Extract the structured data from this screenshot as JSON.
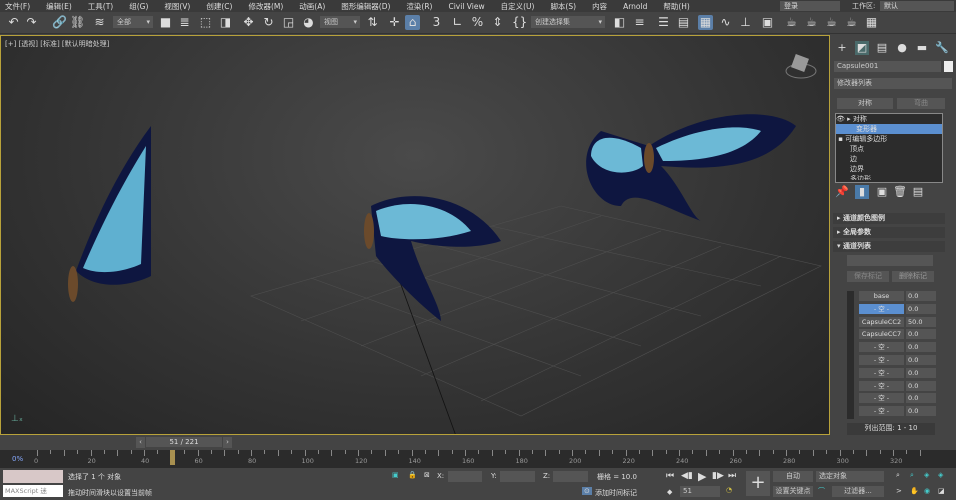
{
  "menu": [
    "文件(F)",
    "编辑(E)",
    "工具(T)",
    "组(G)",
    "视图(V)",
    "创建(C)",
    "修改器(M)",
    "动画(A)",
    "图形编辑器(D)",
    "渲染(R)",
    "Civil View",
    "自定义(U)",
    "脚本(S)",
    "内容",
    "Arnold",
    "帮助(H)"
  ],
  "login": "登录",
  "workspace_label": "工作区:",
  "workspace_value": "默认",
  "toolbar": {
    "selection_filter": "全部",
    "ref_coord": "视图",
    "named_selection": "创建选择集"
  },
  "viewport": {
    "label": "[+] [透视] [标准] [默认明暗处理]"
  },
  "panel": {
    "object_name": "Capsule001",
    "modifier_list": "修改器列表",
    "btn_symmetry": "对称",
    "btn_bend": "弯曲",
    "stack": [
      "对称",
      "变形器",
      "可编辑多边形",
      "顶点",
      "边",
      "边界",
      "多边形"
    ],
    "rollouts": [
      "通道颜色图例",
      "全局参数",
      "通道列表"
    ],
    "btn_save_marker": "保存标记",
    "btn_delete_marker": "删除标记",
    "channels": [
      {
        "name": "base",
        "value": "0.0"
      },
      {
        "name": "- 空 -",
        "value": "0.0"
      },
      {
        "name": "CapsuleCC2",
        "value": "50.0"
      },
      {
        "name": "CapsuleCC7",
        "value": "0.0"
      },
      {
        "name": "- 空 -",
        "value": "0.0"
      },
      {
        "name": "- 空 -",
        "value": "0.0"
      },
      {
        "name": "- 空 -",
        "value": "0.0"
      },
      {
        "name": "- 空 -",
        "value": "0.0"
      },
      {
        "name": "- 空 -",
        "value": "0.0"
      },
      {
        "name": "- 空 -",
        "value": "0.0"
      }
    ],
    "range_label": "列出范围: 1 - 10"
  },
  "timeline": {
    "current": "51 / 221",
    "current_frame": 51,
    "ticks": [
      "0",
      "20",
      "40",
      "60",
      "80",
      "100",
      "120",
      "140",
      "160",
      "180",
      "200",
      "220",
      "240",
      "260",
      "280",
      "300",
      "320"
    ],
    "max": 330,
    "percent": "0%"
  },
  "status": {
    "maxscript": "MAXScript 迷",
    "selected": "选择了 1 个 对象",
    "hint": "拖动时间滑块以设置当前帧",
    "x": "X:",
    "y": "Y:",
    "z": "Z:",
    "grid": "栅格 = 10.0",
    "add_time_tag": "添加时间标记",
    "auto": "自动",
    "set_key": "设置关键点",
    "selected_obj": "选定对象",
    "filters": "过滤器...",
    "frame": "51"
  }
}
